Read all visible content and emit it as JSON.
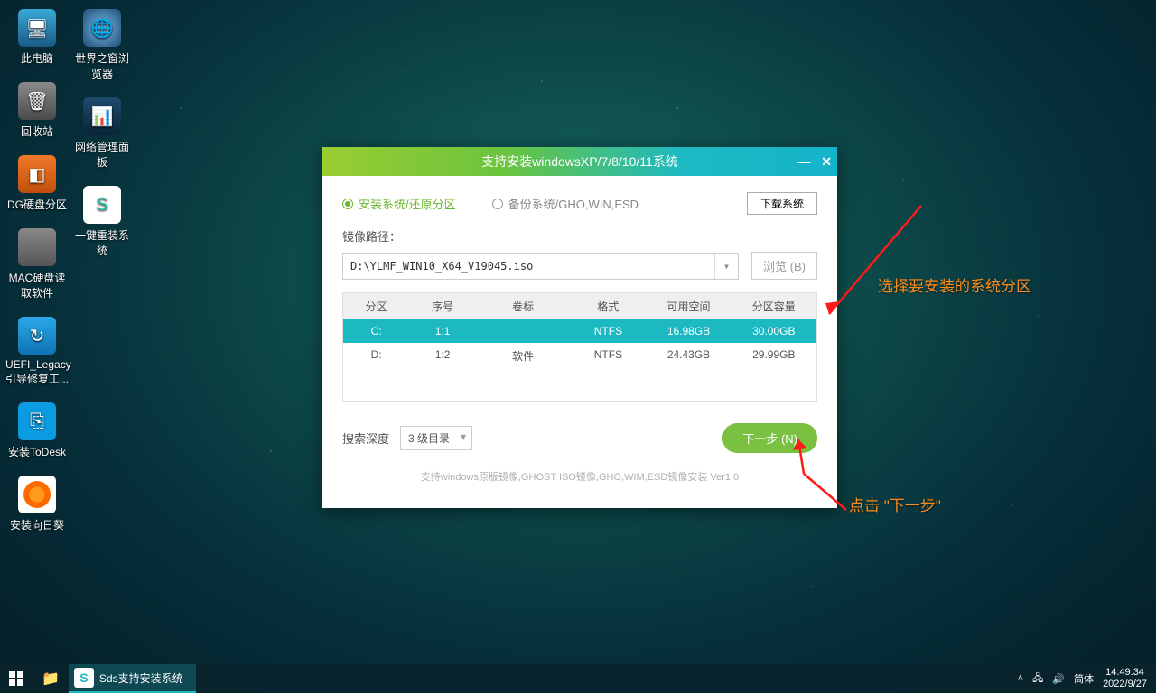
{
  "desktop_icons_col1": [
    "此电脑",
    "回收站",
    "DG硬盘分区",
    "MAC硬盘读取软件",
    "UEFI_Legacy引导修复工...",
    "安装ToDesk",
    "安装向日葵"
  ],
  "desktop_icons_col2": [
    "世界之窗浏览器",
    "网络管理面板",
    "一键重装系统"
  ],
  "window": {
    "title": "支持安装windowsXP/7/8/10/11系统",
    "radio_install": "安装系统/还原分区",
    "radio_backup": "备份系统/GHO,WIN,ESD",
    "download_btn": "下载系统",
    "path_label": "镜像路径：",
    "path_value": "D:\\YLMF_WIN10_X64_V19045.iso",
    "browse_btn": "浏览 (B)",
    "headers": {
      "c1": "分区",
      "c2": "序号",
      "c3": "卷标",
      "c4": "格式",
      "c5": "可用空间",
      "c6": "分区容量"
    },
    "rows": [
      {
        "c1": "C:",
        "c2": "1:1",
        "c3": "",
        "c4": "NTFS",
        "c5": "16.98GB",
        "c6": "30.00GB",
        "selected": true
      },
      {
        "c1": "D:",
        "c2": "1:2",
        "c3": "软件",
        "c4": "NTFS",
        "c5": "24.43GB",
        "c6": "29.99GB",
        "selected": false
      }
    ],
    "depth_label": "搜索深度",
    "depth_value": "3 级目录",
    "next_btn": "下一步 (N)",
    "footer": "支持windows原版镜像,GHOST ISO镜像,GHO,WIM,ESD镜像安装 Ver1.0"
  },
  "annotations": {
    "select_partition": "选择要安装的系统分区",
    "click_next": "点击 \"下一步\""
  },
  "taskbar": {
    "app": "Sds支持安装系统",
    "lang": "简体",
    "time": "14:49:34",
    "date": "2022/9/27"
  }
}
